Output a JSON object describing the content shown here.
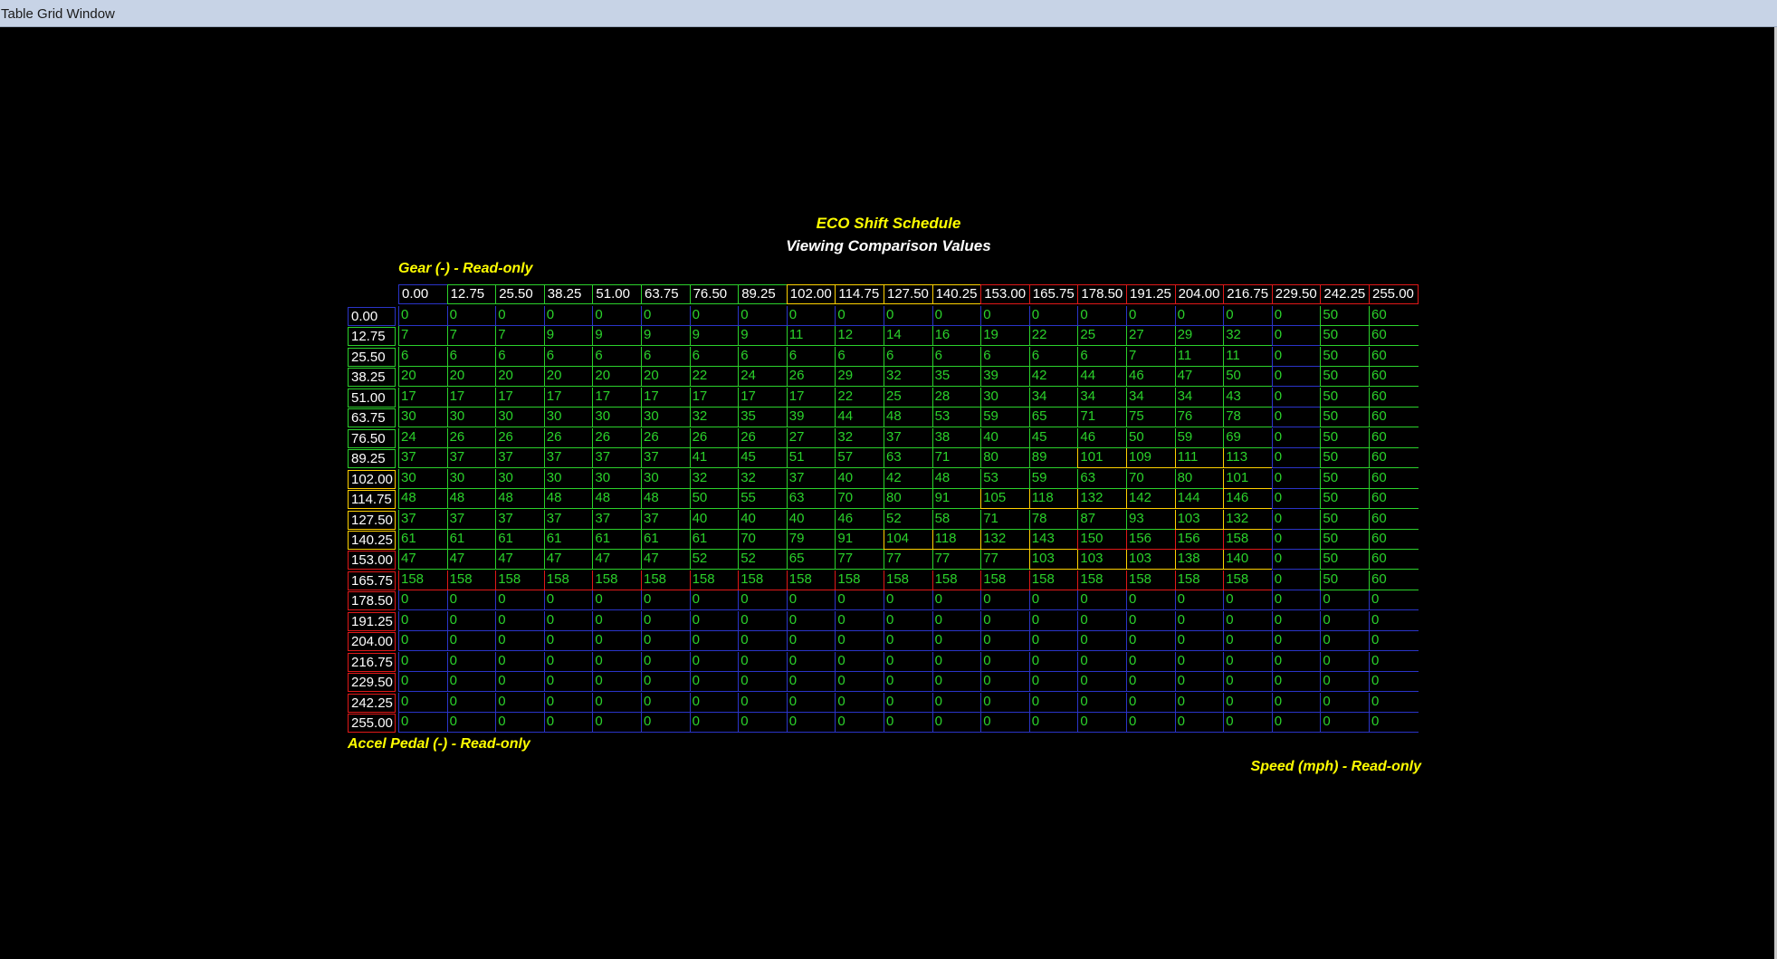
{
  "window": {
    "title": "Table Grid Window"
  },
  "table": {
    "title": "ECO Shift Schedule",
    "subtitle": "Viewing Comparison Values",
    "x_axis_label": "Gear (-) - Read-only",
    "y_axis_label": "Accel Pedal (-) - Read-only",
    "speed_label": "Speed (mph) - Read-only",
    "col_headers": [
      "0.00",
      "12.75",
      "25.50",
      "38.25",
      "51.00",
      "63.75",
      "76.50",
      "89.25",
      "102.00",
      "114.75",
      "127.50",
      "140.25",
      "153.00",
      "165.75",
      "178.50",
      "191.25",
      "204.00",
      "216.75",
      "229.50",
      "242.25",
      "255.00"
    ],
    "row_headers": [
      "0.00",
      "12.75",
      "25.50",
      "38.25",
      "51.00",
      "63.75",
      "76.50",
      "89.25",
      "102.00",
      "114.75",
      "127.50",
      "140.25",
      "153.00",
      "165.75",
      "178.50",
      "191.25",
      "204.00",
      "216.75",
      "229.50",
      "242.25",
      "255.00"
    ],
    "rows": [
      [
        "0",
        "0",
        "0",
        "0",
        "0",
        "0",
        "0",
        "0",
        "0",
        "0",
        "0",
        "0",
        "0",
        "0",
        "0",
        "0",
        "0",
        "0",
        "0",
        "50",
        "60"
      ],
      [
        "7",
        "7",
        "7",
        "9",
        "9",
        "9",
        "9",
        "9",
        "11",
        "12",
        "14",
        "16",
        "19",
        "22",
        "25",
        "27",
        "29",
        "32",
        "0",
        "50",
        "60"
      ],
      [
        "6",
        "6",
        "6",
        "6",
        "6",
        "6",
        "6",
        "6",
        "6",
        "6",
        "6",
        "6",
        "6",
        "6",
        "6",
        "7",
        "11",
        "11",
        "0",
        "50",
        "60"
      ],
      [
        "20",
        "20",
        "20",
        "20",
        "20",
        "20",
        "22",
        "24",
        "26",
        "29",
        "32",
        "35",
        "39",
        "42",
        "44",
        "46",
        "47",
        "50",
        "0",
        "50",
        "60"
      ],
      [
        "17",
        "17",
        "17",
        "17",
        "17",
        "17",
        "17",
        "17",
        "17",
        "22",
        "25",
        "28",
        "30",
        "34",
        "34",
        "34",
        "34",
        "43",
        "0",
        "50",
        "60"
      ],
      [
        "30",
        "30",
        "30",
        "30",
        "30",
        "30",
        "32",
        "35",
        "39",
        "44",
        "48",
        "53",
        "59",
        "65",
        "71",
        "75",
        "76",
        "78",
        "0",
        "50",
        "60"
      ],
      [
        "24",
        "26",
        "26",
        "26",
        "26",
        "26",
        "26",
        "26",
        "27",
        "32",
        "37",
        "38",
        "40",
        "45",
        "46",
        "50",
        "59",
        "69",
        "0",
        "50",
        "60"
      ],
      [
        "37",
        "37",
        "37",
        "37",
        "37",
        "37",
        "41",
        "45",
        "51",
        "57",
        "63",
        "71",
        "80",
        "89",
        "101",
        "109",
        "111",
        "113",
        "0",
        "50",
        "60"
      ],
      [
        "30",
        "30",
        "30",
        "30",
        "30",
        "30",
        "32",
        "32",
        "37",
        "40",
        "42",
        "48",
        "53",
        "59",
        "63",
        "70",
        "80",
        "101",
        "0",
        "50",
        "60"
      ],
      [
        "48",
        "48",
        "48",
        "48",
        "48",
        "48",
        "50",
        "55",
        "63",
        "70",
        "80",
        "91",
        "105",
        "118",
        "132",
        "142",
        "144",
        "146",
        "0",
        "50",
        "60"
      ],
      [
        "37",
        "37",
        "37",
        "37",
        "37",
        "37",
        "40",
        "40",
        "40",
        "46",
        "52",
        "58",
        "71",
        "78",
        "87",
        "93",
        "103",
        "132",
        "0",
        "50",
        "60"
      ],
      [
        "61",
        "61",
        "61",
        "61",
        "61",
        "61",
        "61",
        "70",
        "79",
        "91",
        "104",
        "118",
        "132",
        "143",
        "150",
        "156",
        "156",
        "158",
        "0",
        "50",
        "60"
      ],
      [
        "47",
        "47",
        "47",
        "47",
        "47",
        "47",
        "52",
        "52",
        "65",
        "77",
        "77",
        "77",
        "77",
        "103",
        "103",
        "103",
        "138",
        "140",
        "0",
        "50",
        "60"
      ],
      [
        "158",
        "158",
        "158",
        "158",
        "158",
        "158",
        "158",
        "158",
        "158",
        "158",
        "158",
        "158",
        "158",
        "158",
        "158",
        "158",
        "158",
        "158",
        "0",
        "50",
        "60"
      ],
      [
        "0",
        "0",
        "0",
        "0",
        "0",
        "0",
        "0",
        "0",
        "0",
        "0",
        "0",
        "0",
        "0",
        "0",
        "0",
        "0",
        "0",
        "0",
        "0",
        "0",
        "0"
      ],
      [
        "0",
        "0",
        "0",
        "0",
        "0",
        "0",
        "0",
        "0",
        "0",
        "0",
        "0",
        "0",
        "0",
        "0",
        "0",
        "0",
        "0",
        "0",
        "0",
        "0",
        "0"
      ],
      [
        "0",
        "0",
        "0",
        "0",
        "0",
        "0",
        "0",
        "0",
        "0",
        "0",
        "0",
        "0",
        "0",
        "0",
        "0",
        "0",
        "0",
        "0",
        "0",
        "0",
        "0"
      ],
      [
        "0",
        "0",
        "0",
        "0",
        "0",
        "0",
        "0",
        "0",
        "0",
        "0",
        "0",
        "0",
        "0",
        "0",
        "0",
        "0",
        "0",
        "0",
        "0",
        "0",
        "0"
      ],
      [
        "0",
        "0",
        "0",
        "0",
        "0",
        "0",
        "0",
        "0",
        "0",
        "0",
        "0",
        "0",
        "0",
        "0",
        "0",
        "0",
        "0",
        "0",
        "0",
        "0",
        "0"
      ],
      [
        "0",
        "0",
        "0",
        "0",
        "0",
        "0",
        "0",
        "0",
        "0",
        "0",
        "0",
        "0",
        "0",
        "0",
        "0",
        "0",
        "0",
        "0",
        "0",
        "0",
        "0"
      ],
      [
        "0",
        "0",
        "0",
        "0",
        "0",
        "0",
        "0",
        "0",
        "0",
        "0",
        "0",
        "0",
        "0",
        "0",
        "0",
        "0",
        "0",
        "0",
        "0",
        "0",
        "0"
      ]
    ]
  },
  "colors": {
    "background": "#000000",
    "title": "#ffff00",
    "subtitle": "#ffffff",
    "cell_text": "#2bd12b",
    "grid_low": "#2a34c8",
    "grid_mid": "#2bd12b",
    "grid_high": "#ffd200",
    "grid_max": "#e01818"
  }
}
